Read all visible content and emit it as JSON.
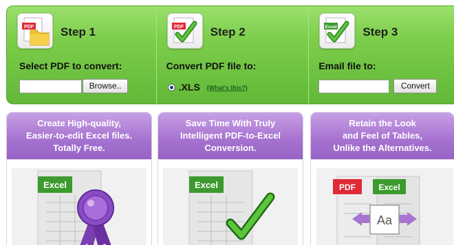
{
  "steps": [
    {
      "title": "Step 1",
      "label": "Select PDF to convert:",
      "browse_button": "Browse.."
    },
    {
      "title": "Step 2",
      "label": "Convert PDF file to:",
      "option_label": ".XLS",
      "help_link": "(What's this?)"
    },
    {
      "title": "Step 3",
      "label": "Email file to:",
      "convert_button": "Convert"
    }
  ],
  "step_icons": [
    "pdf-folder-icon",
    "pdf-checkmark-icon",
    "excel-checkmark-icon"
  ],
  "icon_badges": {
    "pdf": "PDF",
    "excel": "Excel"
  },
  "features": [
    {
      "text": "Create High-quality,\nEasier-to-edit Excel files.\nTotally Free.",
      "icon": "excel-award-ribbon-icon"
    },
    {
      "text": "Save Time With Truly\nIntelligent PDF-to-Excel\nConversion.",
      "icon": "excel-checkmark-icon"
    },
    {
      "text": "Retain the Look\nand Feel of Tables,\nUnlike the Alternatives.",
      "icon": "pdf-to-excel-font-icon"
    }
  ],
  "illustration_badges": {
    "excel": "Excel",
    "pdf": "PDF",
    "font": "Aa"
  },
  "colors": {
    "green_band": "#7ccd4a",
    "purple_header": "#a874d1",
    "badge_green": "#3c9a2e",
    "badge_red": "#e02a36"
  }
}
